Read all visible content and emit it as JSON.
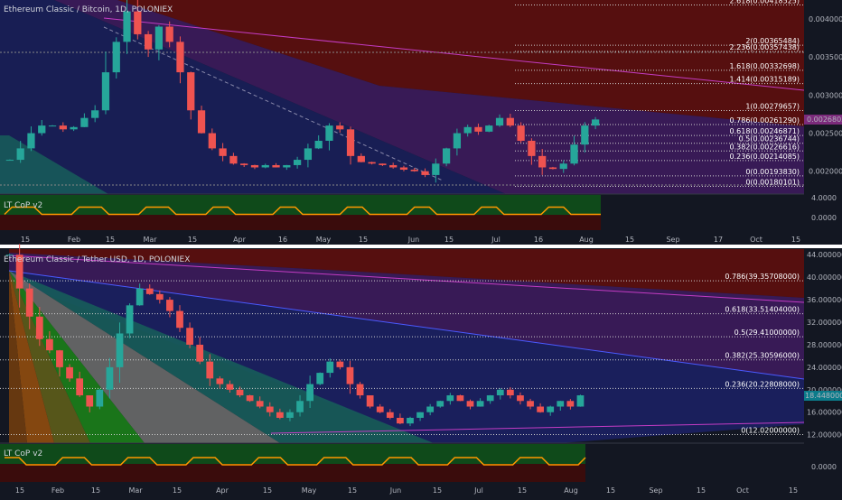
{
  "charts": [
    {
      "title": "Ethereum Classic / Bitcoin, 1D, POLONIEX",
      "indicator": "LT CoP v2",
      "price_badge": "0.00268031",
      "y_ticks": [
        "0.00400000",
        "0.00350000",
        "0.00300000",
        "0.00250000",
        "0.00200000"
      ],
      "ind_ticks": [
        "4.0000",
        "0.0000"
      ],
      "x_ticks": [
        "15",
        "Feb",
        "15",
        "Mar",
        "15",
        "Apr",
        "16",
        "May",
        "15",
        "Jun",
        "15",
        "Jul",
        "16",
        "Aug",
        "15",
        "Sep",
        "17",
        "Oct",
        "15"
      ],
      "fib_levels": [
        {
          "label": "2.618(0.00418525)",
          "value": 0.00418525
        },
        {
          "label": "2(0.00365484)",
          "value": 0.00365484
        },
        {
          "label": "2.236(0.00357438)",
          "value": 0.00357438
        },
        {
          "label": "1.618(0.00332698)",
          "value": 0.00332698
        },
        {
          "label": "1.414(0.00315189)",
          "value": 0.00315189
        },
        {
          "label": "1(0.00279657)",
          "value": 0.00279657
        },
        {
          "label": "0.786(0.00261290)",
          "value": 0.0026129
        },
        {
          "label": "0.618(0.00246871)",
          "value": 0.00246871
        },
        {
          "label": "0.5(0.00236744)",
          "value": 0.00236744
        },
        {
          "label": "0.382(0.00226616)",
          "value": 0.00226616
        },
        {
          "label": "0.236(0.00214085)",
          "value": 0.00214085
        },
        {
          "label": "0(0.00193830)",
          "value": 0.0019383
        },
        {
          "label": "0(0.00180101)",
          "value": 0.00180101
        }
      ],
      "close_path": [
        0.00215,
        0.0023,
        0.0025,
        0.0026,
        0.0026,
        0.00255,
        0.00258,
        0.0027,
        0.0028,
        0.0033,
        0.0037,
        0.0041,
        0.0038,
        0.0036,
        0.0039,
        0.0037,
        0.0033,
        0.0028,
        0.0025,
        0.0023,
        0.0022,
        0.0021,
        0.00208,
        0.00205,
        0.00208,
        0.00205,
        0.00208,
        0.00215,
        0.0023,
        0.0024,
        0.0026,
        0.00255,
        0.0022,
        0.00212,
        0.0021,
        0.00208,
        0.00205,
        0.00202,
        0.002,
        0.00195,
        0.0021,
        0.0023,
        0.0025,
        0.00258,
        0.00252,
        0.0026,
        0.0027,
        0.0026,
        0.0024,
        0.0022,
        0.00205,
        0.00203,
        0.0021,
        0.00235,
        0.0026,
        0.00268
      ]
    },
    {
      "title": "Ethereum Classic / Tether USD, 1D, POLONIEX",
      "indicator": "LT CoP v2",
      "price_badge": "18.44800000",
      "y_ticks": [
        "44.00000000",
        "40.00000000",
        "36.00000000",
        "32.00000000",
        "28.00000000",
        "24.00000000",
        "20.00000000",
        "16.00000000",
        "12.00000000"
      ],
      "ind_ticks": [
        "0.0000"
      ],
      "x_ticks": [
        "15",
        "Feb",
        "15",
        "Mar",
        "15",
        "Apr",
        "15",
        "May",
        "15",
        "Jun",
        "15",
        "Jul",
        "15",
        "Aug",
        "15",
        "Sep",
        "15",
        "Oct",
        "15"
      ],
      "fib_levels": [
        {
          "label": "0.786(39.35708000)",
          "value": 39.35708
        },
        {
          "label": "0.618(33.51404000)",
          "value": 33.51404
        },
        {
          "label": "0.5(29.41000000)",
          "value": 29.41
        },
        {
          "label": "0.382(25.30596000)",
          "value": 25.30596
        },
        {
          "label": "0.236(20.22808000)",
          "value": 20.22808
        },
        {
          "label": "0(12.02000000)",
          "value": 12.02
        }
      ],
      "close_path": [
        44,
        38,
        33,
        29,
        27,
        24,
        22,
        19,
        17,
        20,
        24,
        30,
        35,
        38,
        37,
        36,
        34,
        31,
        28,
        25,
        22,
        21,
        20,
        19,
        18,
        17,
        16,
        15,
        16,
        18,
        21,
        23,
        25,
        24,
        21,
        19,
        17,
        16,
        15,
        14,
        15,
        16,
        17,
        18,
        19,
        18,
        17,
        18,
        19,
        20,
        19,
        18,
        17,
        16,
        17,
        18,
        17,
        19
      ]
    }
  ]
}
